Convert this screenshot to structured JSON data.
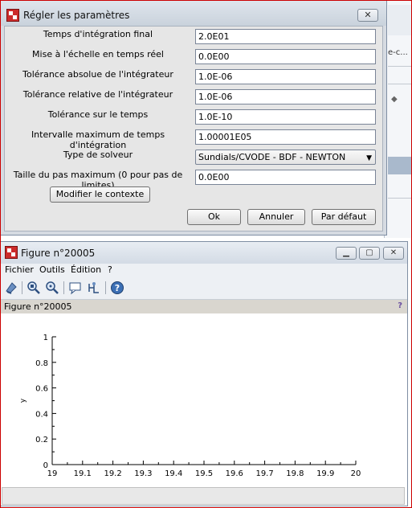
{
  "background_app": {
    "fragment": "e-c..."
  },
  "dialog": {
    "title": "Régler les paramètres",
    "fields": [
      {
        "label": "Temps d'intégration final",
        "value": "2.0E01"
      },
      {
        "label": "Mise à l'échelle en temps réel",
        "value": "0.0E00"
      },
      {
        "label": "Tolérance absolue de l'intégrateur",
        "value": "1.0E-06"
      },
      {
        "label": "Tolérance relative de l'intégrateur",
        "value": "1.0E-06"
      },
      {
        "label": "Tolérance sur le temps",
        "value": "1.0E-10"
      },
      {
        "label": "Intervalle maximum de temps d'intégration",
        "value": "1.00001E05"
      },
      {
        "label": "Type de solveur",
        "value": "Sundials/CVODE - BDF - NEWTON"
      },
      {
        "label": "Taille du pas maximum (0 pour pas de limites)",
        "value": "0.0E00"
      }
    ],
    "context_button": "Modifier le contexte",
    "ok_button": "Ok",
    "cancel_button": "Annuler",
    "default_button": "Par défaut"
  },
  "figure": {
    "title": "Figure n°20005",
    "menu": [
      "Fichier",
      "Outils",
      "Édition",
      "?"
    ],
    "panel_title": "Figure n°20005",
    "help_mark": "?",
    "chart_data": {
      "type": "line",
      "series": [],
      "xlabel": "",
      "ylabel": "y",
      "xlim": [
        19,
        20
      ],
      "ylim": [
        0,
        1
      ],
      "x_ticks": [
        "19",
        "19.1",
        "19.2",
        "19.3",
        "19.4",
        "19.5",
        "19.6",
        "19.7",
        "19.8",
        "19.9",
        "20"
      ],
      "y_ticks": [
        "0",
        "0.2",
        "0.4",
        "0.6",
        "0.8",
        "1"
      ],
      "grid": false
    }
  }
}
